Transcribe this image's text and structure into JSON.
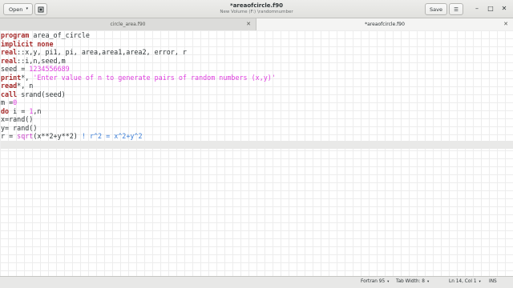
{
  "header": {
    "open_label": "Open",
    "open_caret": "▾",
    "new_doc_icon": "new-document-icon",
    "title": "*areaofcircle.f90",
    "subtitle": "New Volume (F:) \\randomnumber",
    "save_label": "Save",
    "menu_icon": "☰",
    "minimize_glyph": "–",
    "maximize_glyph": "□",
    "close_glyph": "✕"
  },
  "tabs": [
    {
      "label": "circle_area.f90",
      "close": "✕"
    },
    {
      "label": "*areaofcircle.f90",
      "close": "✕"
    }
  ],
  "editor": {
    "lines": [
      "program area_of_circle",
      "implicit none",
      "real::x,y, pi1, pi, area,area1,area2, error, r",
      "real::i,n,seed,m",
      "seed = 1234556689",
      "print*, 'Enter value of n to generate pairs of random numbers (x,y)'",
      "read*, n",
      "call srand(seed)",
      "m =0",
      "do i = 1,n",
      "x=rand()",
      "y= rand()",
      "r = sqrt(x**2+y**2) ! r^2 = x^2+y^2",
      ""
    ],
    "current_line_index": 13
  },
  "status": {
    "language": "Fortran 95",
    "tab_width": "Tab Width: 8",
    "position": "Ln 14, Col 1",
    "mode": "INS",
    "dropdown_glyph": "▾"
  },
  "colors": {
    "keyword": "#a52a2a",
    "string": "#e040e0",
    "comment": "#3d7fd8",
    "current_line": "#e9e9e8"
  }
}
